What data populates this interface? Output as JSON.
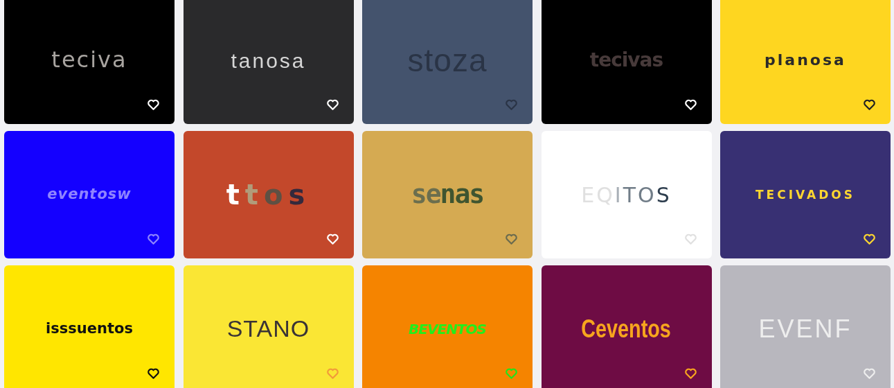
{
  "cards": [
    {
      "color": "#000000",
      "kind": "rounded",
      "logo": [
        {
          "text": "teciva",
          "color": "#a8a4a0"
        }
      ],
      "heart": {
        "color": "#ffffff"
      }
    },
    {
      "color": "#2a2a2c",
      "kind": "thin-wide",
      "logo": [
        {
          "text": "tanosa",
          "color": "#d6d6d6"
        }
      ],
      "heart": {
        "color": "#ffffff"
      }
    },
    {
      "color": "#44536d",
      "kind": "hairline",
      "logo": [
        {
          "text": "stoza",
          "color": "#2a3446"
        }
      ],
      "heart": {
        "color": "#2a3446"
      }
    },
    {
      "color": "#000000",
      "kind": "heavy",
      "logo": [
        {
          "text": "tecivas",
          "color": "#473a3a"
        }
      ],
      "heart": {
        "color": "#ffffff"
      }
    },
    {
      "color": "#fed620",
      "kind": "bold-wide",
      "logo": [
        {
          "text": "planosa",
          "color": "#2a2a2a"
        }
      ],
      "heart": {
        "color": "#222222"
      }
    },
    {
      "color": "#1400ff",
      "kind": "bold-italic",
      "logo": [
        {
          "text": "eventosw",
          "color": "#8f84ff"
        }
      ],
      "heart": {
        "color": "#8f84ff"
      }
    },
    {
      "color": "#c3482b",
      "kind": "rounded-wide",
      "logo": [
        {
          "text": "t",
          "color": "#ffffff"
        },
        {
          "text": "t",
          "color": "#b19c7a"
        },
        {
          "text": "o",
          "color": "#5e5043"
        },
        {
          "text": "s",
          "color": "#34293c"
        }
      ],
      "heart": {
        "color": "#ffffff"
      }
    },
    {
      "color": "#d5aa52",
      "kind": "condensed",
      "logo": [
        {
          "text": "se",
          "color": "#6b6e4e"
        },
        {
          "text": "nas",
          "color": "#3f5530"
        }
      ],
      "heart": {
        "color": "#6b6b4e"
      }
    },
    {
      "color": "#ffffff",
      "kind": "tech",
      "logo": [
        {
          "text": "EQ",
          "color": "#e0e0e0"
        },
        {
          "text": "I",
          "color": "#a8afb6"
        },
        {
          "text": "TO",
          "color": "#717d88"
        },
        {
          "text": "S",
          "color": "#2e3e4e"
        }
      ],
      "heart": {
        "color": "#e0e0e0"
      }
    },
    {
      "color": "#383073",
      "kind": "wide-caps",
      "logo": [
        {
          "text": "TECIVADOS",
          "color": "#fed630"
        }
      ],
      "heart": {
        "color": "#fed630"
      }
    },
    {
      "color": "#ffe600",
      "kind": "heavy-compact",
      "logo": [
        {
          "text": "isssuentos",
          "color": "#111111"
        }
      ],
      "heart": {
        "color": "#111111"
      }
    },
    {
      "color": "#fae634",
      "kind": "geometric",
      "logo": [
        {
          "text": "STANO",
          "color": "#3a3436"
        }
      ],
      "heart": {
        "color": "#f29a3a"
      }
    },
    {
      "color": "#f58400",
      "kind": "italic-heavy",
      "logo": [
        {
          "text": "BEVENTOS",
          "color": "#22ee1c"
        }
      ],
      "heart": {
        "color": "#22e41c"
      }
    },
    {
      "color": "#6e0c44",
      "kind": "condensed-bold",
      "logo": [
        {
          "text": "Ceventos",
          "color": "#f7a51e"
        }
      ],
      "heart": {
        "color": "#f7a51e"
      }
    },
    {
      "color": "#b8b7be",
      "kind": "light-caps",
      "logo": [
        {
          "text": "EVENF",
          "color": "#eeeeee"
        }
      ],
      "heart": {
        "color": "#eeeeee"
      }
    }
  ]
}
